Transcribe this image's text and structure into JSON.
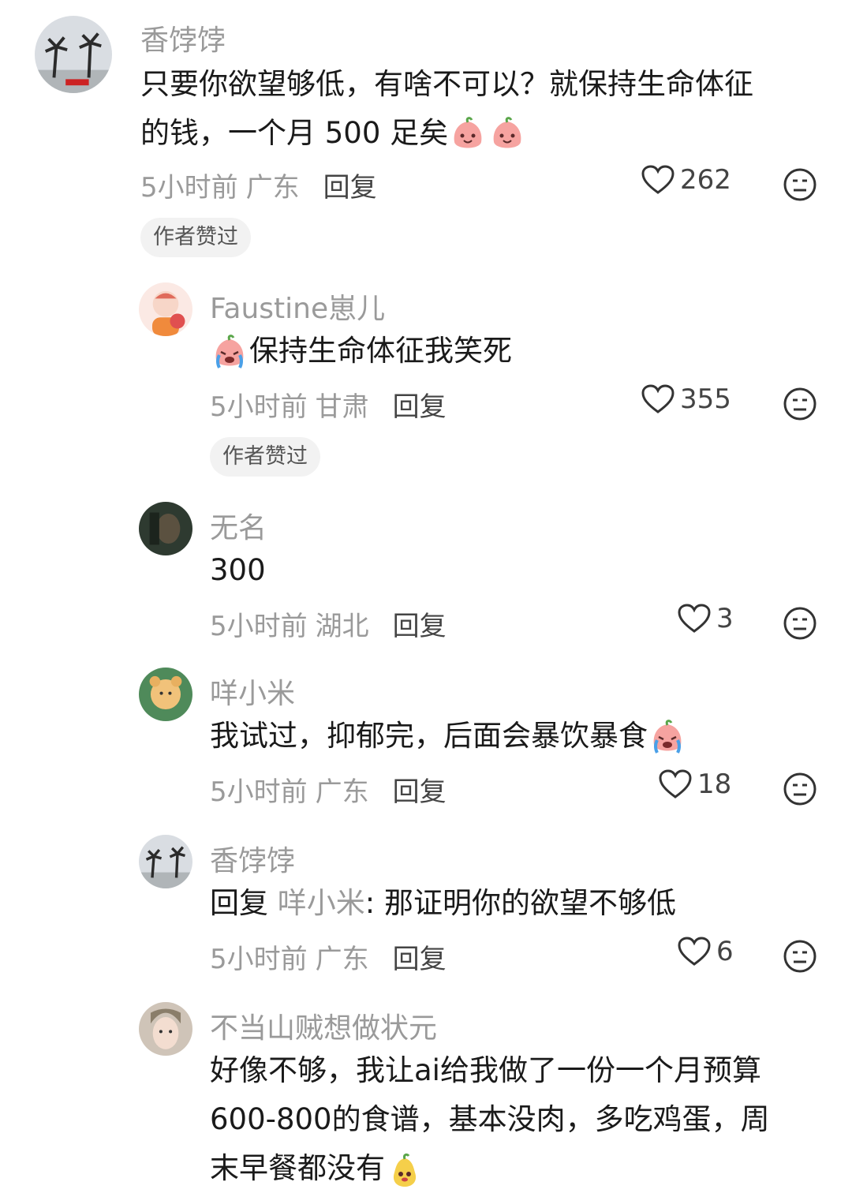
{
  "comments": [
    {
      "username": "香饽饽",
      "lines": [
        "只要你欲望够低，有啥不可以？就保持生命体征",
        "的钱，一个月 500 足矣"
      ],
      "time": "5小时前",
      "location": "广东",
      "reply_label": "回复",
      "likes": "262",
      "badge": "作者赞过"
    },
    {
      "username": "Faustine崽儿",
      "lines": [
        "保持生命体征我笑死"
      ],
      "time": "5小时前",
      "location": "甘肃",
      "reply_label": "回复",
      "likes": "355",
      "badge": "作者赞过"
    },
    {
      "username": "无名",
      "lines": [
        "300"
      ],
      "time": "5小时前",
      "location": "湖北",
      "reply_label": "回复",
      "likes": "3"
    },
    {
      "username": "咩小米",
      "lines": [
        "我试过，抑郁完，后面会暴饮暴食"
      ],
      "time": "5小时前",
      "location": "广东",
      "reply_label": "回复",
      "likes": "18"
    },
    {
      "username": "香饽饽",
      "reply_prefix": "回复",
      "reply_to": "咩小米",
      "reply_text": ": 那证明你的欲望不够低",
      "time": "5小时前",
      "location": "广东",
      "reply_label": "回复",
      "likes": "6"
    },
    {
      "username": "不当山贼想做状元",
      "lines": [
        "好像不够，我让ai给我做了一份一个月预算",
        "600-800的食谱，基本没肉，多吃鸡蛋，周",
        "末早餐都没有"
      ]
    }
  ],
  "colors": {
    "username": "#9a9a9a",
    "text": "#1a1a1a",
    "meta": "#9a9a9a",
    "badge_bg": "#f2f2f2",
    "emoji_peach": "#f6a3a0"
  },
  "icons": [
    "heart-outline-icon",
    "dislike-face-icon",
    "peach-smile-emoji",
    "peach-cry-emoji",
    "pear-face-emoji"
  ]
}
